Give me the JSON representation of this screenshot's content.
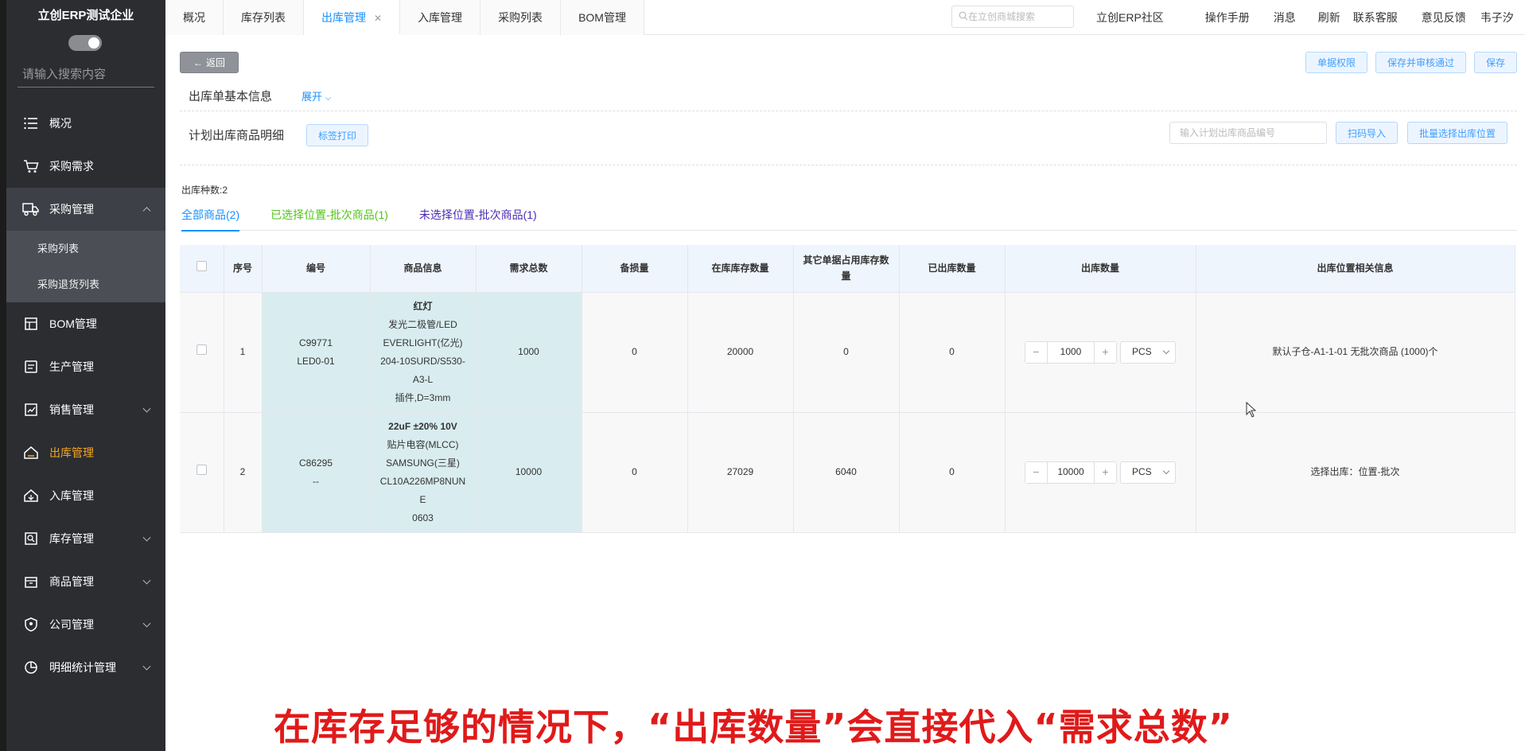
{
  "sidebar": {
    "company": "立创ERP测试企业",
    "search_placeholder": "请输入搜索内容",
    "items": [
      {
        "label": "概况",
        "icon": "list-icon"
      },
      {
        "label": "采购需求",
        "icon": "cart-icon"
      },
      {
        "label": "采购管理",
        "icon": "truck-icon",
        "expanded": true
      },
      {
        "label": "BOM管理",
        "icon": "building-icon"
      },
      {
        "label": "生产管理",
        "icon": "clipboard-icon"
      },
      {
        "label": "销售管理",
        "icon": "sales-icon"
      },
      {
        "label": "出库管理",
        "icon": "outbound-icon",
        "active": true
      },
      {
        "label": "入库管理",
        "icon": "inbound-icon"
      },
      {
        "label": "库存管理",
        "icon": "inventory-icon"
      },
      {
        "label": "商品管理",
        "icon": "box-icon"
      },
      {
        "label": "公司管理",
        "icon": "shield-icon"
      },
      {
        "label": "明细统计管理",
        "icon": "pie-chart-icon"
      }
    ],
    "sub_items": [
      "采购列表",
      "采购退货列表"
    ]
  },
  "topbar": {
    "tabs": [
      "概况",
      "库存列表",
      "出库管理",
      "入库管理",
      "采购列表",
      "BOM管理"
    ],
    "active_tab": "出库管理",
    "search_placeholder": "在立创商城搜索",
    "links": [
      "立创ERP社区",
      "操作手册",
      "消息",
      "刷新",
      "联系客服",
      "意见反馈",
      "韦子汐"
    ]
  },
  "page": {
    "back_label": "返回",
    "right_buttons": [
      "单据权限",
      "保存并审核通过",
      "保存"
    ],
    "basic_info_title": "出库单基本信息",
    "expand_label": "展开",
    "detail_title": "计划出库商品明细",
    "label_print": "标签打印",
    "code_input_placeholder": "输入计划出库商品编号",
    "scan_import": "扫码导入",
    "batch_select": "批量选择出库位置",
    "kinds_count": "出库种数:2",
    "subtabs": [
      "全部商品(2)",
      "已选择位置-批次商品(1)",
      "未选择位置-批次商品(1)"
    ]
  },
  "table": {
    "headers": [
      "序号",
      "编号",
      "商品信息",
      "需求总数",
      "备损量",
      "在库库存数量",
      "其它单据占用库存数量",
      "已出库数量",
      "出库数量",
      "出库位置相关信息"
    ],
    "rows": [
      {
        "index": "1",
        "code": "C99771",
        "code2": "LED0-01",
        "name": "红灯",
        "info": [
          "发光二极管/LED",
          "EVERLIGHT(亿光)",
          "204-10SURD/S530-",
          "A3-L",
          "插件,D=3mm"
        ],
        "demand": "1000",
        "loss": "0",
        "stock": "20000",
        "occupied": "0",
        "shipped": "0",
        "qty": "1000",
        "unit": "PCS",
        "location": "默认子仓-A1-1-01 无批次商品 (1000)个"
      },
      {
        "index": "2",
        "code": "C86295",
        "code2": "--",
        "name": "22uF ±20% 10V",
        "info": [
          "贴片电容(MLCC)",
          "SAMSUNG(三星)",
          "CL10A226MP8NUN",
          "E",
          "0603"
        ],
        "demand": "10000",
        "loss": "0",
        "stock": "27029",
        "occupied": "6040",
        "shipped": "0",
        "qty": "10000",
        "unit": "PCS",
        "location": "选择出库：位置-批次"
      }
    ]
  },
  "caption": "在库存足够的情况下，“出库数量”会直接代入“需求总数”",
  "colors": {
    "sidebar_bg": "#2b2d31",
    "active_menu": "#f5a623",
    "primary": "#1890ff",
    "caption": "#e01a1a"
  }
}
